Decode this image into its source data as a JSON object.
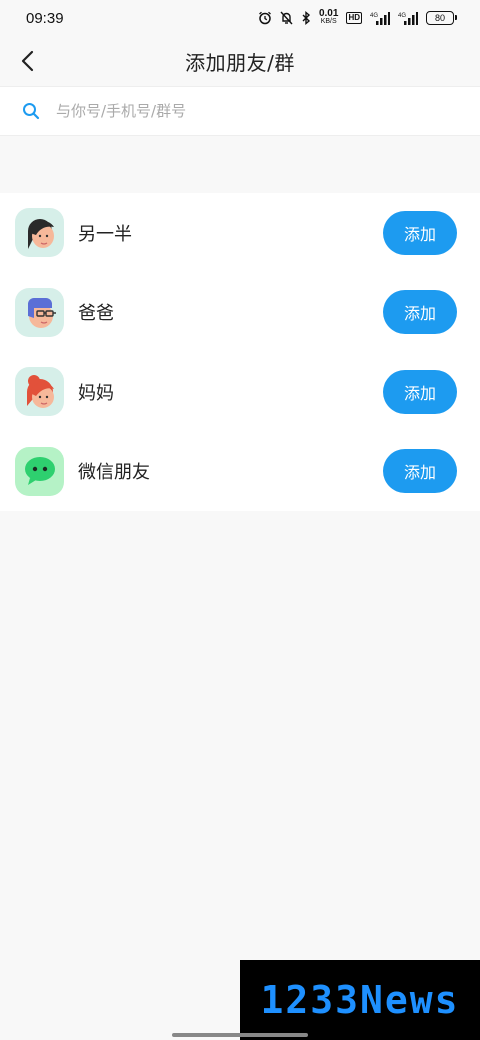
{
  "status_bar": {
    "time": "09:39",
    "net_speed": "0.01",
    "net_unit": "KB/S",
    "hd": "HD",
    "signal1": "4G",
    "signal2": "4G",
    "battery": "80"
  },
  "nav": {
    "title": "添加朋友/群"
  },
  "search": {
    "placeholder": "与你号/手机号/群号"
  },
  "contacts": [
    {
      "label": "另一半",
      "button": "添加",
      "icon": "woman-avatar-icon"
    },
    {
      "label": "爸爸",
      "button": "添加",
      "icon": "man-glasses-avatar-icon"
    },
    {
      "label": "妈妈",
      "button": "添加",
      "icon": "woman-bun-avatar-icon"
    },
    {
      "label": "微信朋友",
      "button": "添加",
      "icon": "wechat-icon"
    }
  ],
  "watermark": "1233News",
  "colors": {
    "accent": "#1d9bf0",
    "avatar_bg": "#d6efe9",
    "wechat_bg": "#b5f2c6",
    "wechat_green": "#2ed06f"
  }
}
